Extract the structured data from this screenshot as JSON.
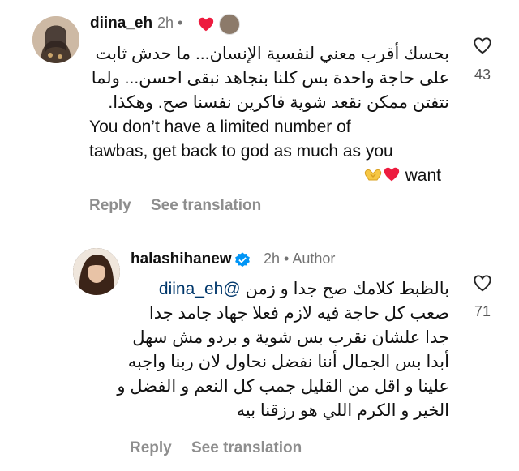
{
  "comments": [
    {
      "username": "diina_eh",
      "time": "2h",
      "separator": "•",
      "lines": [
        "بحسك أقرب معني لنفسية الإنسان... ما حدش ثابت",
        "على حاجة واحدة بس كلنا بنجاهد نبقى احسن... ولما",
        "نتفتن ممكن نقعد شوية فاكرين نفسنا صح. وهكذا.",
        "You don’t have a limited number of",
        "tawbas, get back to god as much as you",
        "want"
      ],
      "likes": "43",
      "reply_label": "Reply",
      "translate_label": "See translation"
    },
    {
      "username": "halashihanew",
      "time": "2h",
      "separator": "•",
      "author_label": "Author",
      "mention": "@diina_eh",
      "lines": [
        "بالظبط كلامك صح جدا و زمن",
        "صعب كل حاجة فيه لازم فعلا جهاد جامد جدا",
        "جدا علشان نقرب بس شوية و بردو مش سهل",
        "أبدا بس الجمال أننا نفضل نحاول لان ربنا واجبه",
        "علينا و اقل من القليل جمب كل النعم و الفضل و",
        "الخير و الكرم اللي هو رزقنا بيه"
      ],
      "likes": "71",
      "reply_label": "Reply",
      "translate_label": "See translation"
    }
  ],
  "colors": {
    "text": "#111111",
    "muted": "#737373",
    "link_gray": "#8e8e8e",
    "heart": "#ed1c3f",
    "verified": "#0095f6",
    "mention": "#00376b"
  }
}
